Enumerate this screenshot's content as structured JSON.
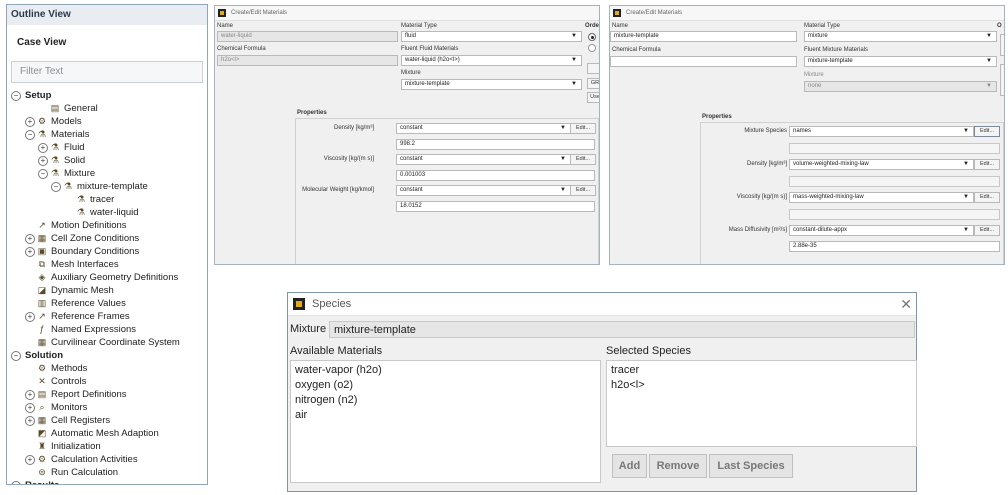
{
  "outline": {
    "header": "Outline View",
    "case_view": "Case View",
    "filter_placeholder": "Filter Text",
    "tree": [
      {
        "label": "Setup",
        "level": 0,
        "toggle": "−",
        "bold": true,
        "icon": ""
      },
      {
        "label": "General",
        "level": 2,
        "toggle": "",
        "icon": "general-icon"
      },
      {
        "label": "Models",
        "level": 1,
        "toggle": "+",
        "icon": "models-icon"
      },
      {
        "label": "Materials",
        "level": 1,
        "toggle": "−",
        "icon": "materials-icon"
      },
      {
        "label": "Fluid",
        "level": 2,
        "toggle": "+",
        "icon": "fluid-icon"
      },
      {
        "label": "Solid",
        "level": 2,
        "toggle": "+",
        "icon": "solid-icon"
      },
      {
        "label": "Mixture",
        "level": 2,
        "toggle": "−",
        "icon": "mixture-icon"
      },
      {
        "label": "mixture-template",
        "level": 3,
        "toggle": "−",
        "icon": "mixture-template-icon"
      },
      {
        "label": "tracer",
        "level": 4,
        "toggle": "",
        "icon": "material-icon"
      },
      {
        "label": "water-liquid",
        "level": 4,
        "toggle": "",
        "icon": "material-icon"
      },
      {
        "label": "Motion Definitions",
        "level": 1,
        "toggle": "",
        "icon": "motion-icon"
      },
      {
        "label": "Cell Zone Conditions",
        "level": 1,
        "toggle": "+",
        "icon": "cell-zone-icon"
      },
      {
        "label": "Boundary Conditions",
        "level": 1,
        "toggle": "+",
        "icon": "boundary-icon"
      },
      {
        "label": "Mesh Interfaces",
        "level": 1,
        "toggle": "",
        "icon": "mesh-interface-icon"
      },
      {
        "label": "Auxiliary Geometry Definitions",
        "level": 1,
        "toggle": "",
        "icon": "aux-geometry-icon"
      },
      {
        "label": "Dynamic Mesh",
        "level": 1,
        "toggle": "",
        "icon": "dynamic-mesh-icon"
      },
      {
        "label": "Reference Values",
        "level": 1,
        "toggle": "",
        "icon": "reference-values-icon"
      },
      {
        "label": "Reference Frames",
        "level": 1,
        "toggle": "+",
        "icon": "reference-frames-icon"
      },
      {
        "label": "Named Expressions",
        "level": 1,
        "toggle": "",
        "icon": "expression-icon"
      },
      {
        "label": "Curvilinear Coordinate System",
        "level": 1,
        "toggle": "",
        "icon": "coordinate-icon"
      },
      {
        "label": "Solution",
        "level": 0,
        "toggle": "−",
        "bold": true,
        "icon": ""
      },
      {
        "label": "Methods",
        "level": 1,
        "toggle": "",
        "icon": "methods-icon"
      },
      {
        "label": "Controls",
        "level": 1,
        "toggle": "",
        "icon": "controls-icon"
      },
      {
        "label": "Report Definitions",
        "level": 1,
        "toggle": "+",
        "icon": "report-icon"
      },
      {
        "label": "Monitors",
        "level": 1,
        "toggle": "+",
        "icon": "monitors-icon"
      },
      {
        "label": "Cell Registers",
        "level": 1,
        "toggle": "+",
        "icon": "registers-icon"
      },
      {
        "label": "Automatic Mesh Adaption",
        "level": 1,
        "toggle": "",
        "icon": "adaption-icon"
      },
      {
        "label": "Initialization",
        "level": 1,
        "toggle": "",
        "icon": "initialization-icon"
      },
      {
        "label": "Calculation Activities",
        "level": 1,
        "toggle": "+",
        "icon": "activities-icon"
      },
      {
        "label": "Run Calculation",
        "level": 1,
        "toggle": "",
        "icon": "run-icon"
      },
      {
        "label": "Results",
        "level": 0,
        "toggle": "−",
        "bold": true,
        "icon": ""
      }
    ]
  },
  "dlg1": {
    "title": "Create/Edit Materials",
    "name_label": "Name",
    "name_value": "water-liquid",
    "formula_label": "Chemical Formula",
    "formula_value": "h2o<l>",
    "material_type_label": "Material Type",
    "material_type_value": "fluid",
    "fluent_label": "Fluent Fluid Materials",
    "fluent_value": "water-liquid (h2o<l>)",
    "mixture_label": "Mixture",
    "mixture_value": "mixture-template",
    "order_label": "Orde",
    "side_btn1": "GR",
    "side_btn2": "Use",
    "properties_label": "Properties",
    "density_label": "Density [kg/m³]",
    "density_method": "constant",
    "density_value": "998.2",
    "viscosity_label": "Viscosity [kg/(m s)]",
    "viscosity_method": "constant",
    "viscosity_value": "0.001003",
    "mw_label": "Molecular Weight [kg/kmol]",
    "mw_method": "constant",
    "mw_value": "18.0152",
    "edit": "Edit..."
  },
  "dlg2": {
    "title": "Create/Edit Materials",
    "name_label": "Name",
    "name_value": "mixture-template",
    "formula_label": "Chemical Formula",
    "formula_value": "",
    "material_type_label": "Material Type",
    "material_type_value": "mixture",
    "fluent_label": "Fluent Mixture Materials",
    "fluent_value": "mixture-template",
    "mixture_label": "Mixture",
    "mixture_value": "none",
    "order_label": "O",
    "properties_label": "Properties",
    "species_label": "Mixture Species",
    "species_method": "names",
    "density_label": "Density [kg/m³]",
    "density_method": "volume-weighted-mixing-law",
    "viscosity_label": "Viscosity [kg/(m s)]",
    "viscosity_method": "mass-weighted-mixing-law",
    "diffusivity_label": "Mass Diffusivity [m²/s]",
    "diffusivity_method": "constant-dilute-appx",
    "diffusivity_value": "2.88e-35",
    "edit": "Edit..."
  },
  "species": {
    "title": "Species",
    "mixture_label": "Mixture",
    "mixture_value": "mixture-template",
    "available_label": "Available Materials",
    "available": [
      "water-vapor (h2o)",
      "oxygen (o2)",
      "nitrogen (n2)",
      "air"
    ],
    "selected_label": "Selected Species",
    "selected": [
      "tracer",
      "h2o<l>"
    ],
    "add": "Add",
    "remove": "Remove",
    "last_species": "Last Species"
  }
}
